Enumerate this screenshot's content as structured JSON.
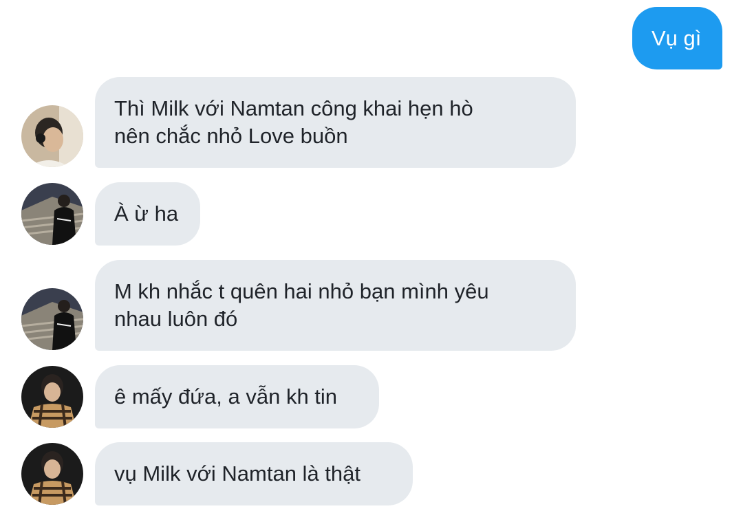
{
  "messages": [
    {
      "sender": "me",
      "text": "Vụ gì"
    },
    {
      "sender": "contact",
      "avatar": "avatar-headphones",
      "text": "Thì Milk với Namtan công khai hẹn hò\nnên chắc nhỏ Love buồn"
    },
    {
      "sender": "contact",
      "avatar": "avatar-stairs",
      "text": "À ừ ha"
    },
    {
      "sender": "contact",
      "avatar": "avatar-stairs",
      "text": "M kh nhắc t quên hai nhỏ bạn mình yêu\nnhau luôn đó"
    },
    {
      "sender": "contact",
      "avatar": "avatar-plaid",
      "text": "ê mấy đứa, a vẫn kh tin"
    },
    {
      "sender": "contact",
      "avatar": "avatar-plaid",
      "text": "vụ Milk với Namtan là thật"
    }
  ],
  "colors": {
    "outgoing_bubble": "#1d9bf0",
    "incoming_bubble": "#e6eaee",
    "incoming_text": "#1f2329"
  }
}
